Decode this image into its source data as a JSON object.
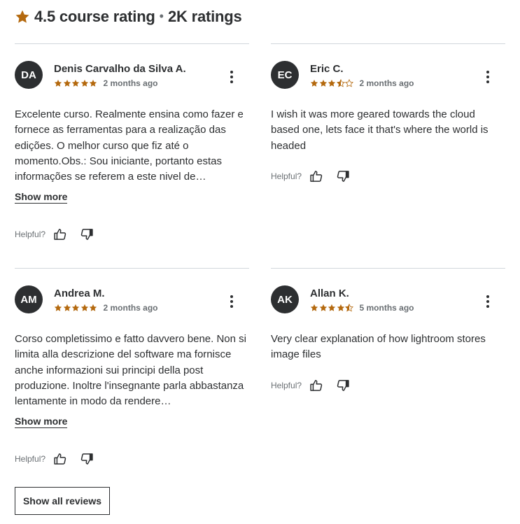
{
  "header": {
    "rating_label": "4.5 course rating",
    "separator": "•",
    "count_label": "2K ratings",
    "star_color": "#b4690e"
  },
  "reviews": [
    {
      "initials": "DA",
      "name": "Denis Carvalho da Silva A.",
      "rating": 5,
      "date": "2 months ago",
      "body": "Excelente curso. Realmente ensina como fazer e fornece as ferramentas para a realização das edições. O melhor curso que fiz até o momento.Obs.: Sou iniciante, portanto estas informações se referem a este nivel de…",
      "show_more": "Show more",
      "helpful_label": "Helpful?"
    },
    {
      "initials": "EC",
      "name": "Eric C.",
      "rating": 3.5,
      "date": "2 months ago",
      "body": "I wish it was more geared towards the cloud based one, lets face it that's where the world is headed",
      "show_more": "",
      "helpful_label": "Helpful?"
    },
    {
      "initials": "AM",
      "name": "Andrea M.",
      "rating": 5,
      "date": "2 months ago",
      "body": "Corso completissimo e fatto davvero bene. Non si limita alla descrizione del software ma fornisce anche informazioni sui principi della post produzione. Inoltre l'insegnante parla abbastanza lentamente in modo da rendere…",
      "show_more": "Show more",
      "helpful_label": "Helpful?"
    },
    {
      "initials": "AK",
      "name": "Allan K.",
      "rating": 4.5,
      "date": "5 months ago",
      "body": "Very clear explanation of how lightroom stores image files",
      "show_more": "",
      "helpful_label": "Helpful?"
    }
  ],
  "show_all_label": "Show all reviews",
  "icons": {
    "header_star": "star-icon",
    "kebab": "more-vertical-icon",
    "thumbs_up": "thumbs-up-icon",
    "thumbs_down": "thumbs-down-icon"
  }
}
